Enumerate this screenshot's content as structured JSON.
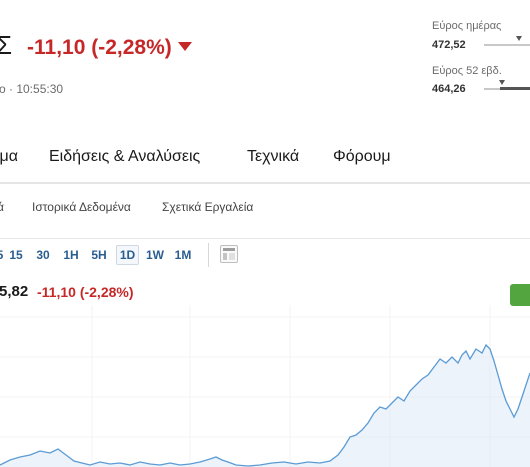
{
  "header": {
    "price_fragment": "Σ",
    "change": "-11,10 (-2,28%)",
    "time": "ο · 10:55:30"
  },
  "day_range": {
    "label": "Εύρος ημέρας",
    "value": "472,52",
    "position": 0.72
  },
  "week52_range": {
    "label": "Εύρος 52 εβδ.",
    "value": "464,26",
    "position": 0.15
  },
  "main_tabs": [
    {
      "label": "ιμα"
    },
    {
      "label": "Ειδήσεις & Αναλύσεις"
    },
    {
      "label": "Τεχνικά"
    },
    {
      "label": "Φόρουμ"
    }
  ],
  "sub_tabs": [
    {
      "label": "ά"
    },
    {
      "label": "Ιστορικά Δεδομένα"
    },
    {
      "label": "Σχετικά Εργαλεία"
    }
  ],
  "timeframes": [
    {
      "label": "5"
    },
    {
      "label": "15"
    },
    {
      "label": "30"
    },
    {
      "label": "1H"
    },
    {
      "label": "5H"
    },
    {
      "label": "1D",
      "active": true
    },
    {
      "label": "1W"
    },
    {
      "label": "1M"
    }
  ],
  "chart_header": {
    "price": "5,82",
    "change": "-11,10 (-2,28%)"
  },
  "colors": {
    "negative": "#c62828",
    "link": "#2a5d8f",
    "chart_line": "#5b9bd5",
    "chart_fill": "#dceaf7",
    "action_green": "#53a53f"
  },
  "icons": {
    "down_arrow": "triangle-down",
    "chart_type": "candles-icon"
  }
}
